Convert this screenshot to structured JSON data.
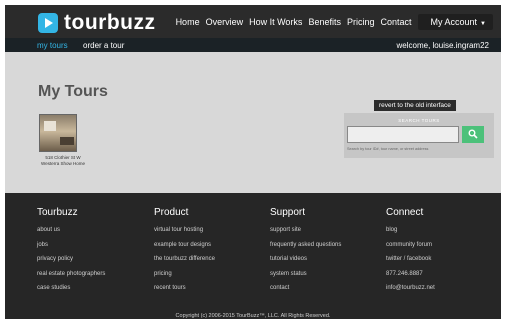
{
  "header": {
    "logo": "tourbuzz",
    "nav": [
      "Home",
      "Overview",
      "How It Works",
      "Benefits",
      "Pricing",
      "Contact"
    ],
    "account_label": "My Account"
  },
  "subnav": {
    "items": [
      "my tours",
      "order a tour"
    ],
    "welcome": "welcome, louise.ingram22"
  },
  "main": {
    "title": "My Tours",
    "tour": {
      "caption_line1": "518 Clothier St W",
      "caption_line2": "Westerra Show Home"
    },
    "revert_label": "revert to the old interface",
    "search": {
      "title": "SEARCH TOURS",
      "hint": "Search by tour ID#, tour name, or street address"
    }
  },
  "footer": {
    "columns": [
      {
        "heading": "Tourbuzz",
        "links": [
          "about us",
          "jobs",
          "privacy policy",
          "real estate photographers",
          "case studies"
        ]
      },
      {
        "heading": "Product",
        "links": [
          "virtual tour hosting",
          "example tour designs",
          "the tourbuzz difference",
          "pricing",
          "recent tours"
        ]
      },
      {
        "heading": "Support",
        "links": [
          "support site",
          "frequently asked questions",
          "tutorial videos",
          "system status",
          "contact"
        ]
      },
      {
        "heading": "Connect",
        "links": [
          "blog",
          "community forum",
          "twitter / facebook",
          "877.246.8887",
          "info@tourbuzz.net"
        ]
      }
    ],
    "copyright": "Copyright (c) 2006-2015 TourBuzz™, LLC. All Rights Reserved."
  },
  "colors": {
    "accent": "#33b5e5",
    "search_button": "#4cc17a",
    "topbar": "#2b2b2b",
    "footer": "#262626"
  },
  "icons": [
    "logo-mark-icon",
    "chevron-down-icon",
    "search-icon"
  ]
}
